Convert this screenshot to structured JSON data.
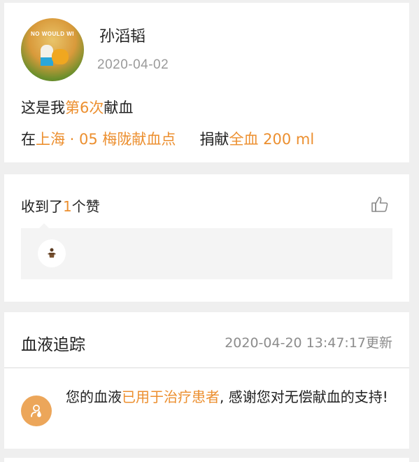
{
  "donation": {
    "user_name": "孙滔韬",
    "date": "2020-04-02",
    "avatar_banner": "NO WOULD WI",
    "count_prefix": "这是我",
    "count_highlight": "第6次",
    "count_suffix": "献血",
    "location_prefix": "在",
    "location": "上海 · 05 梅陇献血点",
    "donation_prefix": "捐献",
    "donation_type_amount": "全血 200 ml"
  },
  "likes": {
    "prefix": "收到了",
    "count": "1",
    "suffix": "个赞",
    "icon": "thumbs-up-icon"
  },
  "tracking": {
    "title": "血液追踪",
    "updated": "2020-04-20 13:47:17更新",
    "status_prefix": "您的血液",
    "status_highlight": "已用于治疗患者",
    "status_suffix": ", 感谢您对无偿献血的支持!",
    "status_icon": "user-drop-icon"
  },
  "colors": {
    "accent": "#ec8f2f",
    "status_icon_bg": "#eca65a",
    "background": "#efefef"
  }
}
